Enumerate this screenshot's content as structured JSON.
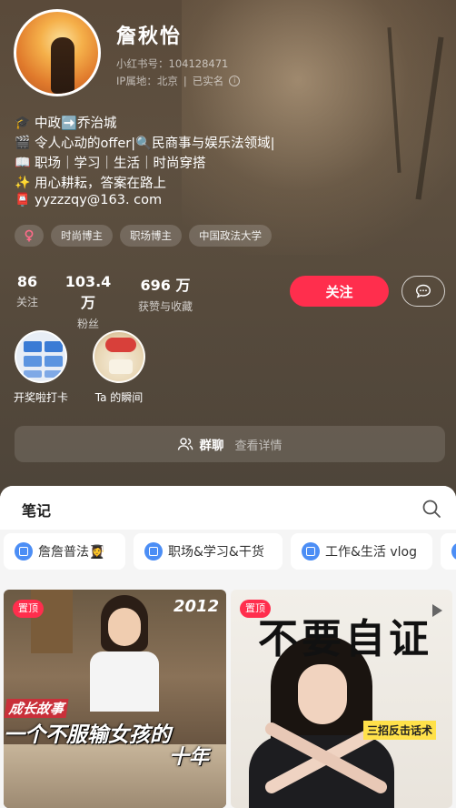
{
  "profile": {
    "name": "詹秋怡",
    "redbook_id": "小红书号：104128471",
    "ip_location": "IP属地：北京",
    "verified": "已实名",
    "bio": [
      {
        "icon": "graduation-cap-icon",
        "text": "中政➡️乔治城"
      },
      {
        "icon": "clapper-icon",
        "text": "令人心动的offer|🔍民商事与娱乐法领域|"
      },
      {
        "icon": "book-icon",
        "text": "职场｜学习｜生活｜时尚穿搭"
      },
      {
        "icon": "sparkles-icon",
        "text": "用心耕耘，答案在路上"
      },
      {
        "icon": "mailbox-icon",
        "text": "yyzzzqy@163. com"
      }
    ],
    "tags": [
      "时尚博主",
      "职场博主",
      "中国政法大学"
    ],
    "stats": [
      {
        "value": "86",
        "label": "关注"
      },
      {
        "value": "103.4 万",
        "label": "粉丝"
      },
      {
        "value": "696 万",
        "label": "获赞与收藏"
      }
    ],
    "follow_label": "关注",
    "highlights": [
      {
        "label": "开奖啦打卡"
      },
      {
        "label": "Ta 的瞬间"
      }
    ],
    "group_chat": {
      "title": "群聊",
      "subtitle": "查看详情"
    }
  },
  "notes": {
    "title": "笔记",
    "collections": [
      {
        "label": "詹詹普法👩‍🎓"
      },
      {
        "label": "职场&学习&干货"
      },
      {
        "label": "工作&生活 vlog"
      }
    ],
    "cards": [
      {
        "badge": "置顶",
        "year": "2012",
        "overlay_small": "成长故事",
        "overlay_main": "一个不服输女孩的",
        "overlay_big": "十年"
      },
      {
        "badge": "置顶",
        "overlay_main": "不要自证",
        "overlay_sub": "三招反击话术"
      }
    ]
  },
  "colors": {
    "accent": "#ff2e4d",
    "collection_icon": "#4c8ef5",
    "highlight_yellow": "#ffe14a"
  }
}
